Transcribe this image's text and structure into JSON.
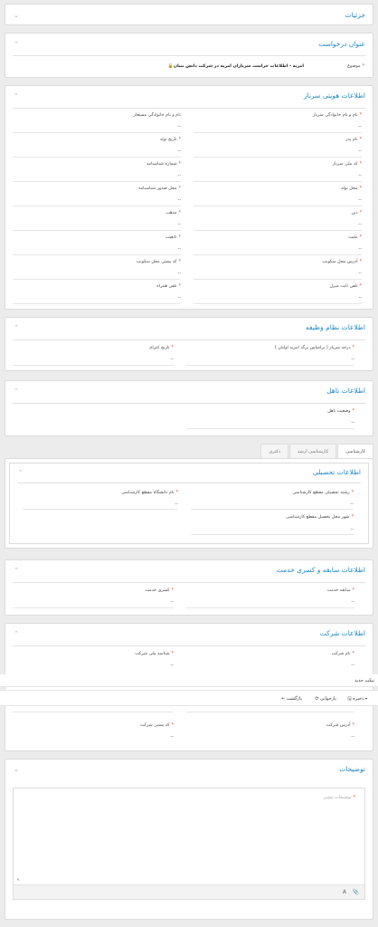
{
  "details": {
    "title": "جزئیات"
  },
  "request": {
    "title": "عنوان درخواست",
    "subject_label": "موضوع",
    "subject_value": "امریه - اطلاعات حراست سربازان امریه در شرکت دانش بنیان"
  },
  "identity": {
    "title": "اطلاعات هویتی سرباز",
    "right_fields": [
      "نام و نام خانوادگی سرباز",
      "نام پدر",
      "کد ملی سرباز",
      "محل تولد",
      "دین",
      "ملیت",
      "آدرس محل سکونت",
      "تلفن ثابت منزل"
    ],
    "left_fields": [
      "نام و نام خانوادگی مستعار",
      "تاریخ تولد",
      "شماره شناسنامه",
      "محل صدور شناسنامه",
      "مذهب",
      "تابعیت",
      "کد پستی محل سکونت",
      "تلفن همراه"
    ]
  },
  "duty": {
    "title": "اطلاعات نظام وظیفه",
    "rank_label": "درجه سرباز ( براساس برگه امریه اولیان )",
    "date_label": "تاریخ اعزام"
  },
  "marital": {
    "title": "اطلاعات تاهل",
    "status_label": "وضعیت تاهل"
  },
  "tabs": [
    "کارشناسی",
    "کارشناسی ارشد",
    "دکتری"
  ],
  "education": {
    "title": "اطلاعات تحصیلی",
    "field_label": "رشته تحصیلی مقطع کارشناسی",
    "uni_label": "نام دانشگاه مقطع کارشناسی",
    "city_label": "شهر محل تحصیل مقطع کارشناسی"
  },
  "service": {
    "title": "اطلاعات سابقه و کسری خدمت",
    "record_label": "سابقه خدمت",
    "deficit_label": "کسری خدمت"
  },
  "company": {
    "title": "اطلاعات شرکت",
    "name_label": "نام شرکت",
    "national_id_label": "شناسه ملی شرکت",
    "address_label": "آدرس شرکت",
    "postal_label": "کد پستی شرکت"
  },
  "ticket": {
    "title": "تیکت جدید"
  },
  "toolbar": {
    "save": "ذخیره",
    "refresh": "بازخوانی",
    "back": "بازگشت"
  },
  "notes": {
    "title": "توضیحات",
    "placeholder": "توضیحات بیشتر"
  },
  "empty": "--"
}
